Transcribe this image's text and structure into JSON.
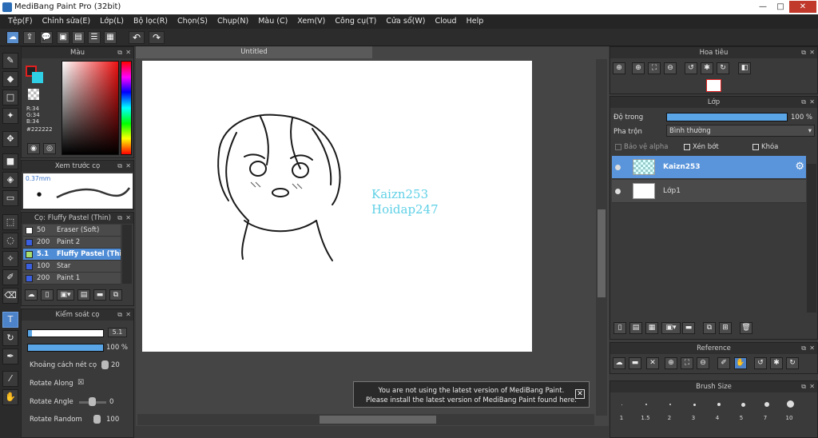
{
  "window": {
    "title": "MediBang Paint Pro (32bit)",
    "controls": [
      "—",
      "□",
      "✕"
    ]
  },
  "menu": [
    "Tệp(F)",
    "Chỉnh sửa(E)",
    "Lớp(L)",
    "Bộ lọc(R)",
    "Chọn(S)",
    "Chụp(N)",
    "Màu (C)",
    "Xem(V)",
    "Công cụ(T)",
    "Cửa sổ(W)",
    "Cloud",
    "Help"
  ],
  "panels": {
    "color": {
      "title": "Màu",
      "r": "R:34",
      "g": "G:34",
      "b": "B:34",
      "hex": "#222222",
      "fg": "#222222",
      "bg": "#2fd0e6"
    },
    "preview": {
      "title": "Xem trước cọ",
      "size": "0.37mm"
    },
    "brushes": {
      "title": "Cọ: Fluffy Pastel (Thin)",
      "items": [
        {
          "size": "50",
          "name": "Eraser (Soft)",
          "color": "#ffffff"
        },
        {
          "size": "200",
          "name": "Paint 2",
          "color": "#3a5fe0"
        },
        {
          "size": "5.1",
          "name": "Fluffy Pastel (Thin)",
          "color": "#a8e070",
          "selected": true
        },
        {
          "size": "100",
          "name": "Star",
          "color": "#3a5fe0"
        },
        {
          "size": "200",
          "name": "Paint 1",
          "color": "#3a5fe0"
        }
      ]
    },
    "control": {
      "title": "Kiểm soát cọ",
      "size_value": "5.1",
      "opacity_value": "100 %",
      "opacity_fraction": 1.0,
      "size_fraction": 0.05,
      "spacing_label": "Khoảng cách nét cọ",
      "spacing_value": "20",
      "rotate_along_label": "Rotate Along",
      "rotate_along_mark": "☒",
      "rotate_angle_label": "Rotate Angle",
      "rotate_angle_value": "0",
      "rotate_random_label": "Rotate Random",
      "rotate_random_value": "100"
    },
    "navigator": {
      "title": "Hoa tiêu"
    },
    "layer": {
      "title": "Lớp",
      "opacity_label": "Độ trong",
      "opacity_value": "100 %",
      "blend_label": "Pha trộn",
      "blend_value": "Bình thường",
      "protect_alpha": "Bảo vệ alpha",
      "clipping": "Xén bớt",
      "lock": "Khóa",
      "layers": [
        {
          "name": "Kaizn253",
          "selected": true
        },
        {
          "name": "Lớp1",
          "selected": false
        }
      ]
    },
    "reference": {
      "title": "Reference"
    },
    "brush_size": {
      "title": "Brush Size",
      "sizes": [
        "1",
        "1.5",
        "2",
        "3",
        "4",
        "5",
        "7",
        "10"
      ]
    }
  },
  "document": {
    "tab": "Untitled"
  },
  "watermark": {
    "line1": "Kaizn253",
    "line2": "Hoidap247"
  },
  "notice": {
    "line1": "You are not using the latest version of MediBang Paint.",
    "line2": "Please install the latest version of MediBang Paint found here."
  }
}
